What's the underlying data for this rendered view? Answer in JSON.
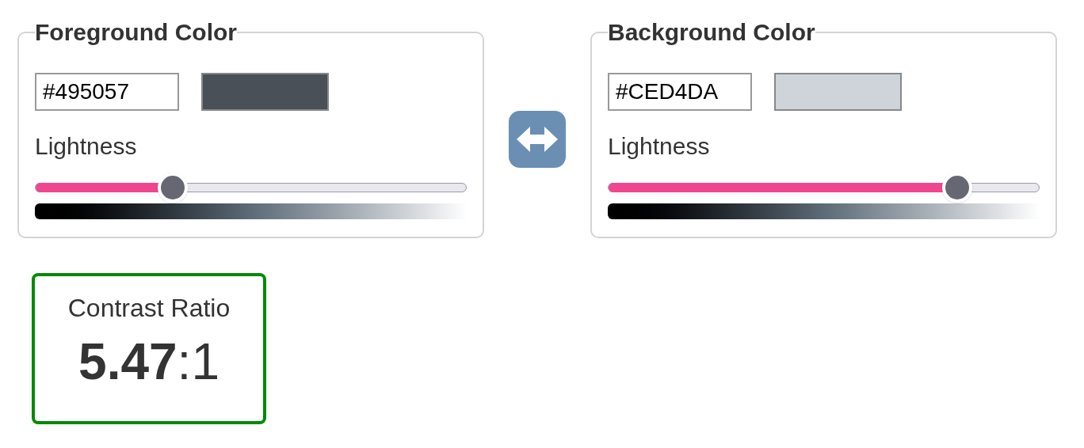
{
  "panels": [
    {
      "title": "Foreground Color",
      "value": "#495057",
      "color": "#495057",
      "slider_label": "Lightness",
      "level": 0.32
    },
    {
      "title": "Background Color",
      "value": "#CED4DA",
      "color": "#ced4da",
      "slider_label": "Lightness",
      "level": 0.81
    }
  ],
  "contrast": {
    "title": "Contrast Ratio",
    "ratio": "**5.47**:1",
    "pass": true
  }
}
